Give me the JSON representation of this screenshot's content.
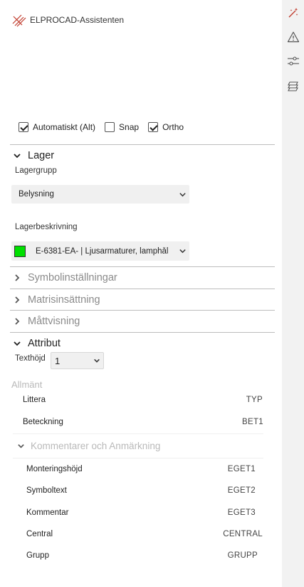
{
  "app": {
    "title": "ELPROCAD-Assistenten"
  },
  "toolbar": {
    "icons": [
      "magic-wand-icon",
      "warning-icon",
      "sliders-icon",
      "layers-icon"
    ]
  },
  "options": {
    "auto_label": "Automatiskt (Alt)",
    "auto_checked": true,
    "snap_label": "Snap",
    "snap_checked": false,
    "ortho_label": "Ortho",
    "ortho_checked": true
  },
  "lager": {
    "section_label": "Lager",
    "group_label": "Lagergrupp",
    "group_value": "Belysning",
    "desc_label": "Lagerbeskrivning",
    "desc_value": "E-6381-EA- | Ljusarmaturer, lamphål",
    "desc_color": "#00e000"
  },
  "sections": {
    "symbol": "Symbolinställningar",
    "matris": "Matrisinsättning",
    "matt": "Måttvisning",
    "attribut": "Attribut"
  },
  "attribut": {
    "text_height_label": "Texthöjd",
    "text_height_value": "1",
    "group_title": "Allmänt",
    "general": [
      {
        "name": "Littera",
        "value": "TYP"
      },
      {
        "name": "Beteckning",
        "value": "BET1"
      }
    ],
    "subgroup_title": "Kommentarer och Anmärkning",
    "comments": [
      {
        "name": "Monteringshöjd",
        "value": "EGET1"
      },
      {
        "name": "Symboltext",
        "value": "EGET2"
      },
      {
        "name": "Kommentar",
        "value": "EGET3"
      },
      {
        "name": "Central",
        "value": "CENTRAL"
      },
      {
        "name": "Grupp",
        "value": "GRUPP"
      }
    ]
  },
  "colors": {
    "accent_red": "#c0392b",
    "divider": "#bdbdbd",
    "muted_text": "#8a8a8a"
  }
}
